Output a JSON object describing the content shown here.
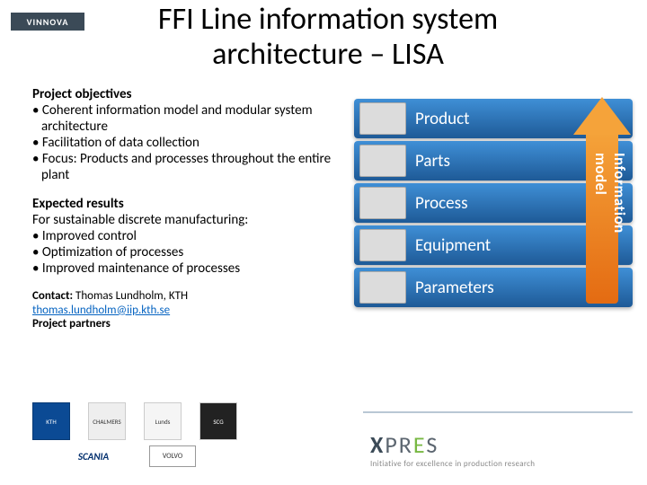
{
  "logo_vinnova": "VINNOVA",
  "title": "FFI Line information system architecture – LISA",
  "sections": {
    "obj_head": "Project objectives",
    "obj_items": [
      "Coherent information model and modular system architecture",
      "Facilitation of data collection",
      "Focus: Products and processes throughout the entire plant"
    ],
    "res_head": "Expected results",
    "res_intro": "For sustainable discrete manufacturing:",
    "res_items": [
      "Improved control",
      "Optimization of processes",
      "Improved maintenance of processes"
    ],
    "contact_label": "Contact:",
    "contact_name": "Thomas Lundholm,  KTH",
    "contact_email": "thomas.lundholm@iip.kth.se",
    "partners_head": "Project partners"
  },
  "partners_row1": [
    "KTH",
    "CHALMERS",
    "Lunds",
    "SCG"
  ],
  "partners_row2": [
    "SCANIA",
    "VOLVO"
  ],
  "diagram": {
    "bars": [
      {
        "label": "Product"
      },
      {
        "label": "Parts"
      },
      {
        "label": "Process"
      },
      {
        "label": "Equipment"
      },
      {
        "label": "Parameters"
      }
    ],
    "arrow_label": "Information\nmodel"
  },
  "xpres": {
    "name_pre": "X",
    "name_mid": "PR",
    "name_dot": "E",
    "name_end": "S",
    "tagline": "Initiative for excellence in production research"
  }
}
